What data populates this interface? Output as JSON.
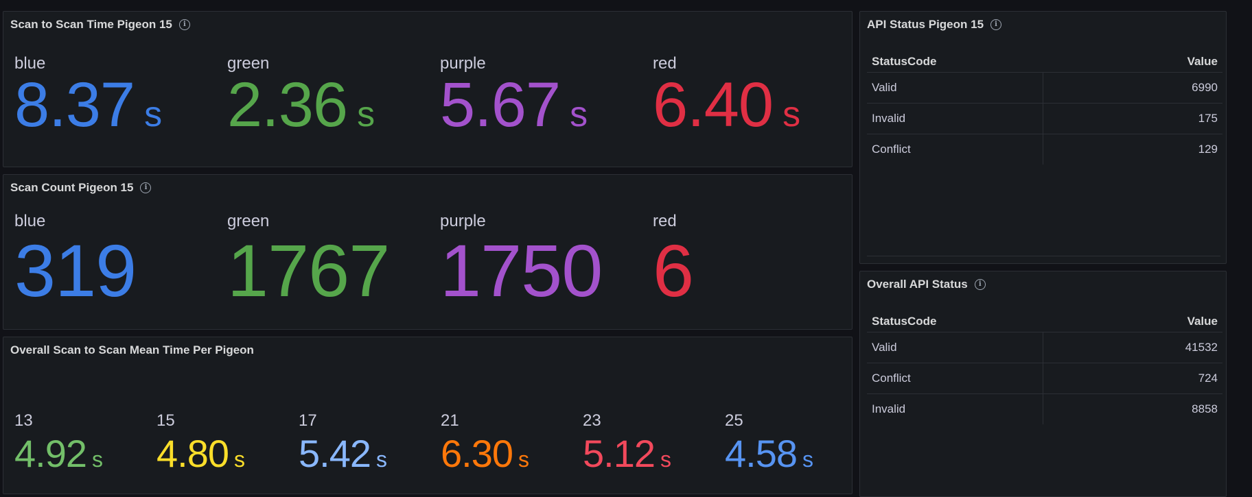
{
  "colors": {
    "blue": "#3c7de6",
    "green": "#56a64b",
    "purple": "#a352cc",
    "red": "#e02f44",
    "light_green": "#73bf69",
    "yellow": "#fade2a",
    "light_blue": "#8ab8ff",
    "orange": "#ff780a",
    "pink_red": "#f2495c",
    "mid_blue": "#5794f2"
  },
  "panel1": {
    "title": "Scan to Scan Time Pigeon 15",
    "info_icon": "info-icon",
    "stats": [
      {
        "name": "blue",
        "value": "8.37",
        "unit": "s"
      },
      {
        "name": "green",
        "value": "2.36",
        "unit": "s"
      },
      {
        "name": "purple",
        "value": "5.67",
        "unit": "s"
      },
      {
        "name": "red",
        "value": "6.40",
        "unit": "s"
      }
    ]
  },
  "panel2": {
    "title": "Scan Count Pigeon 15",
    "info_icon": "info-icon",
    "stats": [
      {
        "name": "blue",
        "value": "319"
      },
      {
        "name": "green",
        "value": "1767"
      },
      {
        "name": "purple",
        "value": "1750"
      },
      {
        "name": "red",
        "value": "6"
      }
    ]
  },
  "panel3": {
    "title": "Overall Scan to Scan Mean Time Per Pigeon",
    "stats": [
      {
        "name": "13",
        "value": "4.92",
        "unit": "s"
      },
      {
        "name": "15",
        "value": "4.80",
        "unit": "s"
      },
      {
        "name": "17",
        "value": "5.42",
        "unit": "s"
      },
      {
        "name": "21",
        "value": "6.30",
        "unit": "s"
      },
      {
        "name": "23",
        "value": "5.12",
        "unit": "s"
      },
      {
        "name": "25",
        "value": "4.58",
        "unit": "s"
      }
    ]
  },
  "panel4": {
    "title": "API Status Pigeon 15",
    "info_icon": "info-icon",
    "columns": [
      "StatusCode",
      "Value"
    ],
    "rows": [
      {
        "code": "Valid",
        "value": "6990"
      },
      {
        "code": "Invalid",
        "value": "175"
      },
      {
        "code": "Conflict",
        "value": "129"
      }
    ]
  },
  "panel5": {
    "title": "Overall API Status",
    "info_icon": "info-icon",
    "columns": [
      "StatusCode",
      "Value"
    ],
    "rows": [
      {
        "code": "Valid",
        "value": "41532"
      },
      {
        "code": "Conflict",
        "value": "724"
      },
      {
        "code": "Invalid",
        "value": "8858"
      }
    ]
  }
}
